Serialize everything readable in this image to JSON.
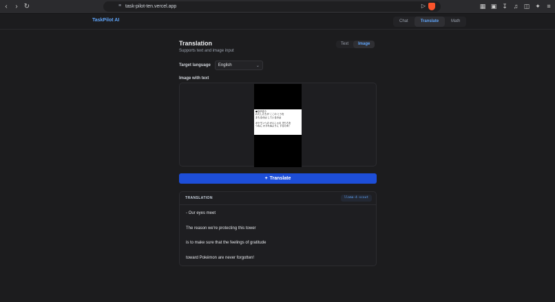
{
  "browser": {
    "url": "task-pilot-ten.vercel.app"
  },
  "app": {
    "brand": "TaskPilot AI",
    "nav": [
      "Chat",
      "Translate",
      "Math"
    ],
    "active_nav": "Translate"
  },
  "page": {
    "title": "Translation",
    "subtitle": "Supports text and image input",
    "modes": [
      "Text",
      "Image"
    ],
    "active_mode": "Image",
    "target_language_label": "Target language",
    "target_language_value": "English",
    "image_label": "Image with text",
    "image_text_lines": [
      "●目が合う",
      "わたしたちが ここの とうを",
      "まもるのは しているのは",
      "",
      "ポケモンへの かんしゃの きもちを",
      "つねに わすれぬように するため！"
    ],
    "translate_button_label": "Translate",
    "translate_button_icon": "plus-icon"
  },
  "result": {
    "header": "TRANSLATION",
    "model": "llama-4-scout",
    "lines": [
      "- Our eyes meet",
      "The reason we're protecting this tower",
      "is to make sure that the feelings of gratitude",
      "toward Pokémon are never forgotten!"
    ]
  }
}
